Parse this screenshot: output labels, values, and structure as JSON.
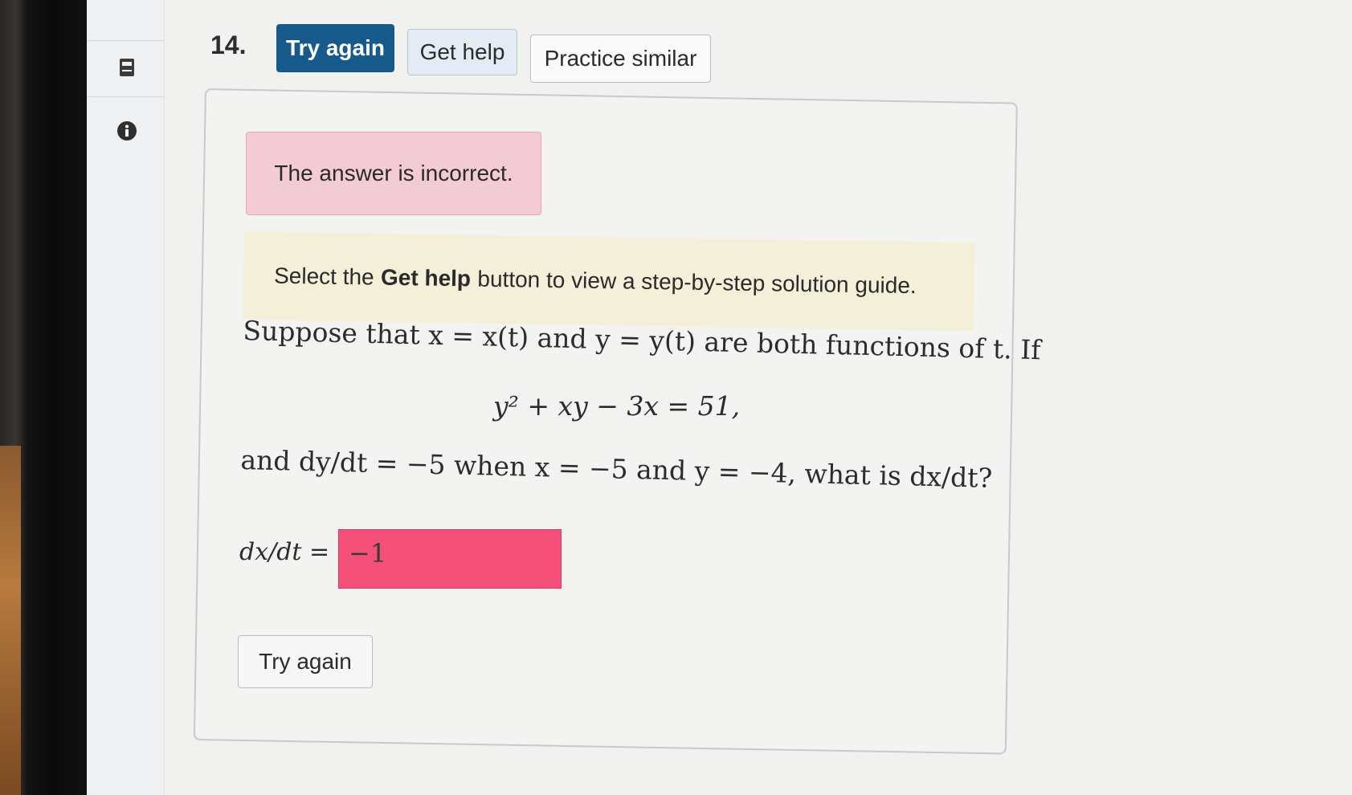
{
  "question": {
    "number": "14.",
    "buttons": {
      "try_again": "Try again",
      "get_help": "Get help",
      "practice_similar": "Practice similar"
    }
  },
  "feedback": {
    "incorrect": "The answer is incorrect.",
    "help_prefix": "Select the",
    "help_bold": "Get help",
    "help_suffix": "button to view a step-by-step solution guide."
  },
  "problem": {
    "line1": "Suppose that x = x(t) and y = y(t) are both functions of t. If",
    "equation": "y² + xy − 3x = 51,",
    "line2": "and dy/dt = −5 when x = −5 and y = −4, what is dx/dt?"
  },
  "answer": {
    "label": "dx/dt =",
    "value": "−1",
    "status_color": "#f4507a"
  },
  "submit": {
    "label": "Try again"
  },
  "colors": {
    "primary": "#155a8a",
    "error_bg": "#f2cbd4",
    "hint_bg": "#f4efd9"
  }
}
